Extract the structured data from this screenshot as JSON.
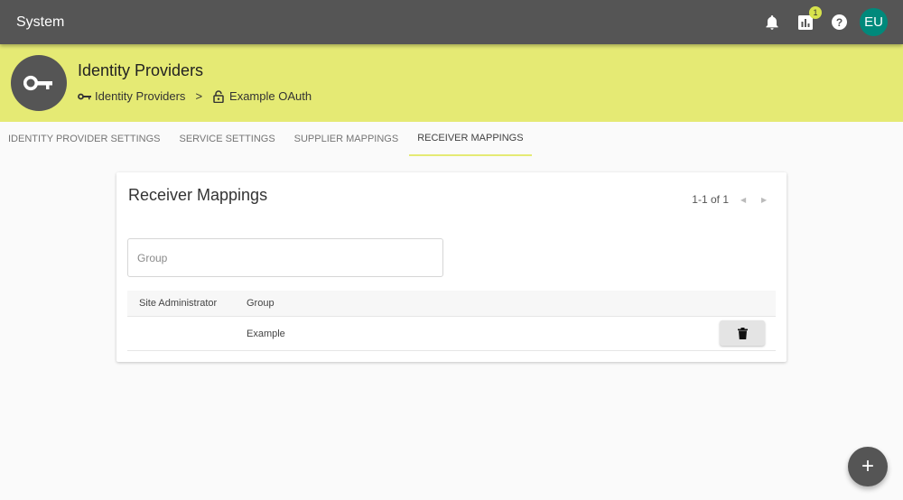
{
  "topbar": {
    "title": "System",
    "icons": [
      "bell-icon",
      "chart-icon",
      "help-icon"
    ],
    "notification_badge": "1",
    "avatar_initials": "EU"
  },
  "header": {
    "title": "Identity Providers",
    "icon": "key-icon",
    "breadcrumbs": [
      {
        "label": "Identity Providers",
        "icon": "key-icon"
      },
      {
        "label": "Example OAuth",
        "icon": "lock-open-icon"
      }
    ],
    "separator": ">"
  },
  "tabs": [
    {
      "label": "Identity Provider Settings",
      "active": false
    },
    {
      "label": "Service Settings",
      "active": false
    },
    {
      "label": "Supplier Mappings",
      "active": false
    },
    {
      "label": "Receiver Mappings",
      "active": true
    }
  ],
  "card": {
    "title": "Receiver Mappings",
    "pagination": "1-1 of 1",
    "group_input": {
      "value": "",
      "placeholder": "Group"
    },
    "table": {
      "columns": [
        "Site Administrator",
        "Group"
      ],
      "rows": [
        {
          "site_administrator": "",
          "group": "Example"
        }
      ]
    }
  },
  "fab": {
    "label": "+"
  },
  "colors": {
    "topbar": "#555555",
    "header": "#e5ea74",
    "avatar": "#00897b",
    "badge": "#d7e34c"
  }
}
